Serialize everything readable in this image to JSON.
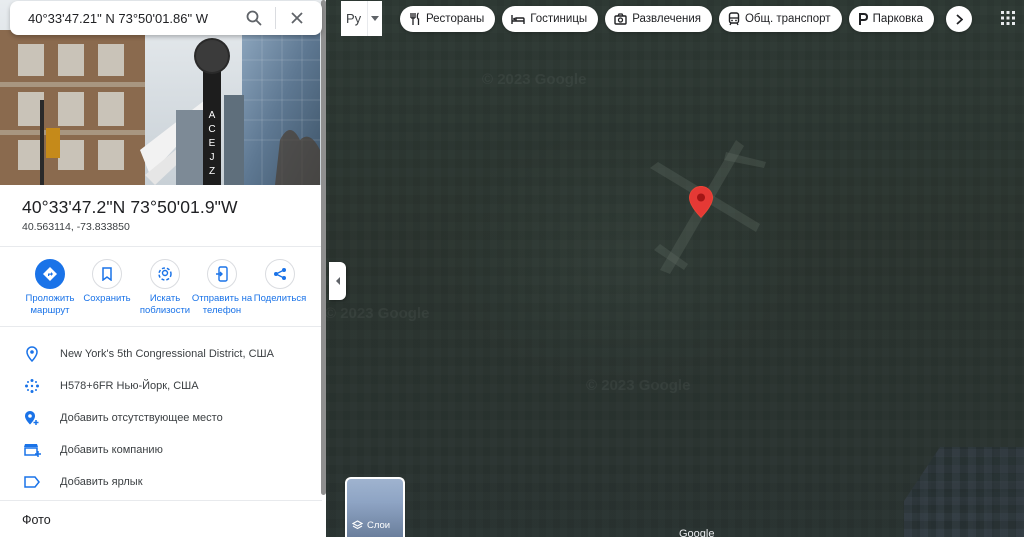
{
  "search": {
    "value": "40°33'47.21\" N 73°50'01.86\" W",
    "search_icon": "search-icon",
    "close_icon": "close-icon"
  },
  "place": {
    "title": "40°33'47.2\"N 73°50'01.9\"W",
    "decimal": "40.563114, -73.833850"
  },
  "actions": [
    {
      "label": "Проложить маршрут",
      "icon": "directions-icon"
    },
    {
      "label": "Сохранить",
      "icon": "bookmark-icon"
    },
    {
      "label": "Искать поблизости",
      "icon": "nearby-icon"
    },
    {
      "label": "Отправить на телефон",
      "icon": "send-to-phone-icon"
    },
    {
      "label": "Поделиться",
      "icon": "share-icon"
    }
  ],
  "info_rows": [
    {
      "text": "New York's 5th Congressional District, США",
      "icon": "location-pin-icon"
    },
    {
      "text": "H578+6FR Нью-Йорк, США",
      "icon": "plus-code-icon"
    },
    {
      "text": "Добавить отсутствующее место",
      "icon": "add-place-icon"
    },
    {
      "text": "Добавить компанию",
      "icon": "add-business-icon"
    },
    {
      "text": "Добавить ярлык",
      "icon": "label-icon"
    }
  ],
  "photos_heading": "Фото",
  "language": {
    "label": "Ру"
  },
  "chips": [
    {
      "label": "Рестораны",
      "icon": "restaurant-icon"
    },
    {
      "label": "Гостиницы",
      "icon": "hotel-icon"
    },
    {
      "label": "Развлечения",
      "icon": "camera-icon"
    },
    {
      "label": "Общ. транспорт",
      "icon": "transit-icon"
    },
    {
      "label": "Парковка",
      "icon": "parking-icon"
    }
  ],
  "map": {
    "watermark": "© 2023 Google",
    "bottom_label": "Google"
  },
  "layers": {
    "label": "Слои"
  },
  "colors": {
    "accent": "#1a73e8",
    "pin": "#ea4335",
    "map_bg": "#2b3530"
  }
}
